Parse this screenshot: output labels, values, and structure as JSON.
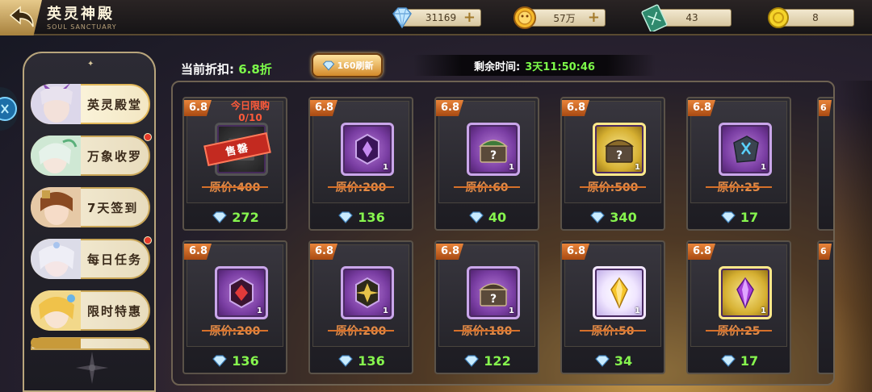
{
  "header": {
    "title": "英灵神殿",
    "subtitle": "SOUL SANCTUARY"
  },
  "resources": [
    {
      "name": "diamond",
      "icon": "diamond-icon",
      "value": "31169",
      "has_plus": true
    },
    {
      "name": "gold",
      "icon": "gold-coin-icon",
      "value": "57万",
      "has_plus": true
    },
    {
      "name": "ticket",
      "icon": "green-ticket-icon",
      "value": "43",
      "has_plus": false
    },
    {
      "name": "token",
      "icon": "yellow-token-icon",
      "value": "8",
      "has_plus": false
    }
  ],
  "sidebar": {
    "items": [
      {
        "label": "英灵殿堂",
        "active": true,
        "red_dot": false
      },
      {
        "label": "万象收罗",
        "active": false,
        "red_dot": true
      },
      {
        "label": "7天签到",
        "active": false,
        "red_dot": false
      },
      {
        "label": "每日任务",
        "active": false,
        "red_dot": true
      },
      {
        "label": "限时特惠",
        "active": false,
        "red_dot": false
      }
    ]
  },
  "shop": {
    "discount_label": "当前折扣:",
    "discount_value": "6.8折",
    "refresh_label": "160刷新",
    "timer_label": "剩余时间:",
    "timer_value": "3天11:50:46",
    "orig_prefix": "原价:",
    "items": [
      {
        "badge": "6.8",
        "orig": "400",
        "price": "272",
        "icon": "sold-out-chest-icon",
        "style": "gray",
        "limit_line1": "今日限购",
        "limit_line2": "0/10",
        "sold_out": "售罄"
      },
      {
        "badge": "6.8",
        "orig": "200",
        "price": "136",
        "icon": "purple-crystal-rune-icon",
        "style": "purple",
        "count": "1"
      },
      {
        "badge": "6.8",
        "orig": "60",
        "price": "40",
        "icon": "mystery-chest-icon",
        "style": "purple",
        "count": "1"
      },
      {
        "badge": "6.8",
        "orig": "500",
        "price": "340",
        "icon": "gold-mystery-chest-icon",
        "style": "gold",
        "count": "1"
      },
      {
        "badge": "6.8",
        "orig": "25",
        "price": "17",
        "icon": "blue-rune-stone-icon",
        "style": "purple",
        "count": "1"
      },
      {
        "badge": "6.8",
        "orig": "200",
        "price": "136",
        "icon": "red-rune-icon",
        "style": "purple",
        "count": "1"
      },
      {
        "badge": "6.8",
        "orig": "200",
        "price": "136",
        "icon": "gold-emblem-rune-icon",
        "style": "purple",
        "count": "1"
      },
      {
        "badge": "6.8",
        "orig": "180",
        "price": "122",
        "icon": "mystery-chest-icon",
        "style": "purple",
        "count": "1"
      },
      {
        "badge": "6.8",
        "orig": "50",
        "price": "34",
        "icon": "yellow-gem-icon",
        "style": "light",
        "count": "1"
      },
      {
        "badge": "6.8",
        "orig": "25",
        "price": "17",
        "icon": "purple-gem-icon",
        "style": "gold",
        "count": "1"
      }
    ],
    "partial_badge": "6"
  },
  "colors": {
    "accent_green": "#7dfc4a",
    "price_orange": "#e28a46",
    "badge_orange": "#e9843a",
    "frame_gold": "#c9a658"
  }
}
